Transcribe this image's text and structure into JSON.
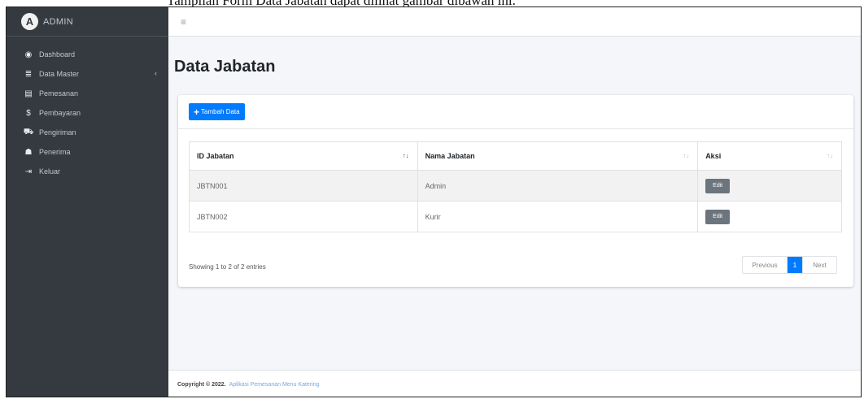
{
  "caption": "Tampilan Form Data Jabatan dapat dilihat gambar dibawah ini.",
  "brand": {
    "logo_letter": "A",
    "text": "ADMIN"
  },
  "sidebar": {
    "items": [
      {
        "label": "Dashboard",
        "icon": "dashboard-icon",
        "glyph": "◉"
      },
      {
        "label": "Data Master",
        "icon": "database-icon",
        "glyph": "≣",
        "arrow": "‹"
      },
      {
        "label": "Pemesanan",
        "icon": "file-icon",
        "glyph": "▤"
      },
      {
        "label": "Pembayaran",
        "icon": "dollar-icon",
        "glyph": "$"
      },
      {
        "label": "Pengiriman",
        "icon": "truck-icon",
        "glyph": "⛟"
      },
      {
        "label": "Penerima",
        "icon": "people-icon",
        "glyph": "☗"
      },
      {
        "label": "Keluar",
        "icon": "logout-icon",
        "glyph": "⇥"
      }
    ]
  },
  "navbar": {
    "menu_glyph": "≡"
  },
  "page_title": "Data Jabatan",
  "add_button": {
    "glyph": "+",
    "label": "Tambah Data"
  },
  "table": {
    "columns": [
      {
        "label": "ID Jabatan",
        "sort": "↑↓"
      },
      {
        "label": "Nama Jabatan",
        "sort": "↑↓"
      },
      {
        "label": "Aksi",
        "sort": "↑↓"
      }
    ],
    "rows": [
      {
        "id": "JBTN001",
        "nama": "Admin",
        "action": "Edit"
      },
      {
        "id": "JBTN002",
        "nama": "Kurir",
        "action": "Edit"
      }
    ]
  },
  "info": "Showing 1 to 2 of 2 entries",
  "pagination": {
    "previous": "Previous",
    "current": "1",
    "next": "Next"
  },
  "footer": {
    "copyright": "Copyright © 2022.",
    "app_name": "Aplikasi Pemesanan Menu Katering"
  },
  "colors": {
    "sidebar": "#343a40",
    "primary": "#007bff",
    "secondary": "#6c757d",
    "background": "#f4f6f9"
  }
}
